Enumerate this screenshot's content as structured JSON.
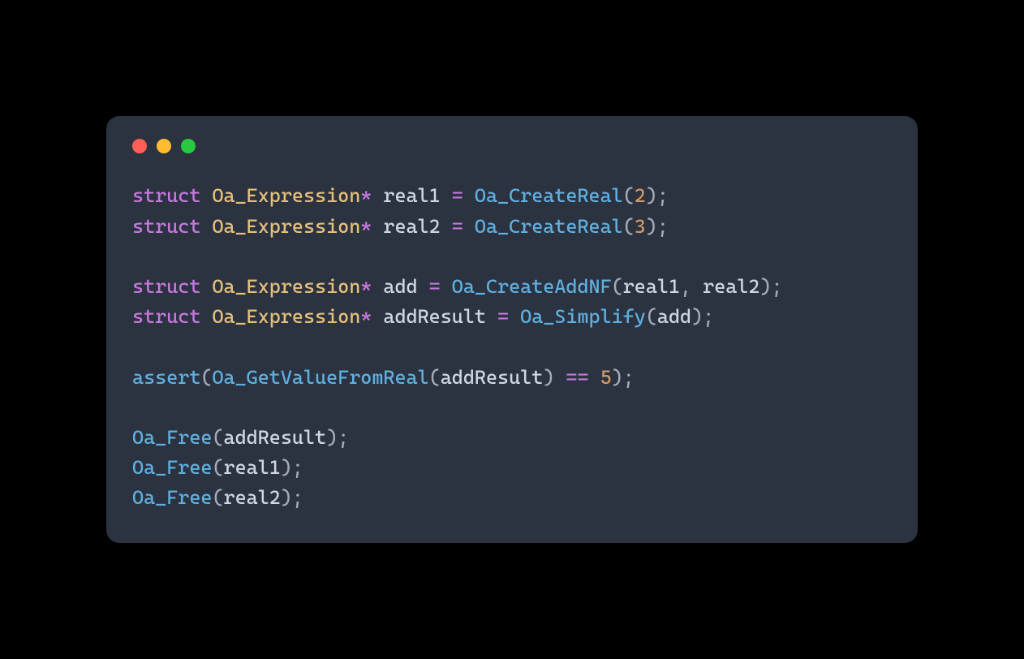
{
  "traffic": {
    "red": "#ff5f57",
    "yellow": "#febc2e",
    "green": "#28c840"
  },
  "code": {
    "l1": {
      "kw": "struct",
      "type": "Oa_Expression",
      "star": "*",
      "name": "real1",
      "eq": "=",
      "fn": "Oa_CreateReal",
      "arg": "2",
      "end": ";"
    },
    "l2": {
      "kw": "struct",
      "type": "Oa_Expression",
      "star": "*",
      "name": "real2",
      "eq": "=",
      "fn": "Oa_CreateReal",
      "arg": "3",
      "end": ";"
    },
    "l3": {
      "kw": "struct",
      "type": "Oa_Expression",
      "star": "*",
      "name": "add",
      "eq": "=",
      "fn": "Oa_CreateAddNF",
      "arg1": "real1",
      "arg2": "real2",
      "end": ";"
    },
    "l4": {
      "kw": "struct",
      "type": "Oa_Expression",
      "star": "*",
      "name": "addResult",
      "eq": "=",
      "fn": "Oa_Simplify",
      "arg": "add",
      "end": ";"
    },
    "l5": {
      "fn": "assert",
      "innerFn": "Oa_GetValueFromReal",
      "arg": "addResult",
      "op": "==",
      "num": "5",
      "end": ";"
    },
    "l6": {
      "fn": "Oa_Free",
      "arg": "addResult",
      "end": ";"
    },
    "l7": {
      "fn": "Oa_Free",
      "arg": "real1",
      "end": ";"
    },
    "l8": {
      "fn": "Oa_Free",
      "arg": "real2",
      "end": ";"
    }
  }
}
